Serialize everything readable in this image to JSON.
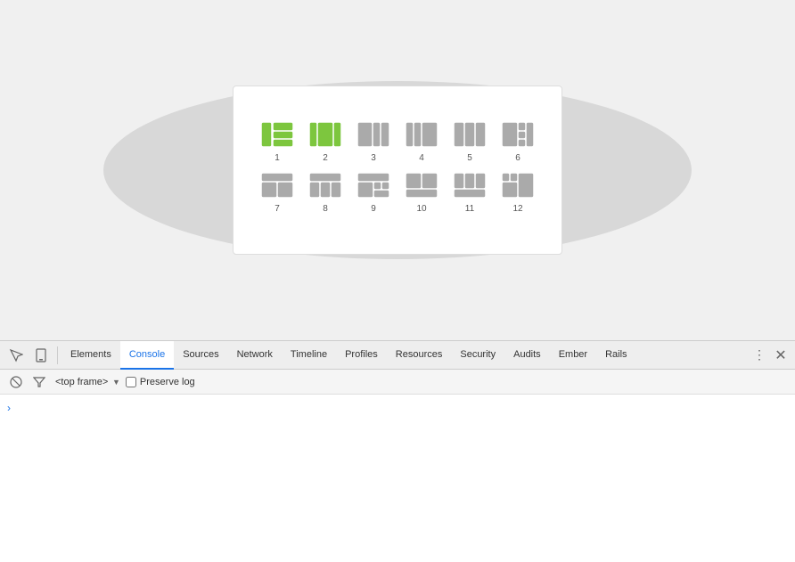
{
  "main": {
    "background": "#f0f0f0"
  },
  "panel": {
    "row1": [
      {
        "label": "1",
        "color": "green"
      },
      {
        "label": "2",
        "color": "green"
      },
      {
        "label": "3",
        "color": "gray"
      },
      {
        "label": "4",
        "color": "gray"
      },
      {
        "label": "5",
        "color": "gray"
      },
      {
        "label": "6",
        "color": "gray"
      }
    ],
    "row2": [
      {
        "label": "7",
        "color": "gray"
      },
      {
        "label": "8",
        "color": "gray"
      },
      {
        "label": "9",
        "color": "gray"
      },
      {
        "label": "10",
        "color": "gray"
      },
      {
        "label": "11",
        "color": "gray"
      },
      {
        "label": "12",
        "color": "gray"
      }
    ]
  },
  "devtools": {
    "tabs": [
      {
        "label": "Elements",
        "active": false
      },
      {
        "label": "Console",
        "active": true
      },
      {
        "label": "Sources",
        "active": false
      },
      {
        "label": "Network",
        "active": false
      },
      {
        "label": "Timeline",
        "active": false
      },
      {
        "label": "Profiles",
        "active": false
      },
      {
        "label": "Resources",
        "active": false
      },
      {
        "label": "Security",
        "active": false
      },
      {
        "label": "Audits",
        "active": false
      },
      {
        "label": "Ember",
        "active": false
      },
      {
        "label": "Rails",
        "active": false
      }
    ],
    "frame_label": "<top frame>",
    "preserve_log": "Preserve log",
    "more_label": "⋮",
    "close_label": "✕"
  }
}
